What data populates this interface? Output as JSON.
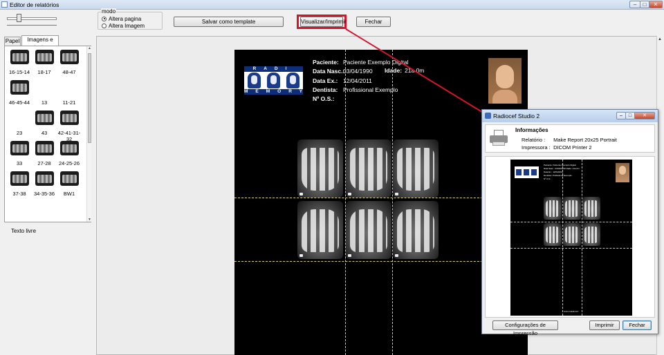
{
  "window": {
    "title": "Editor de relatórios",
    "minimize": "–",
    "maximize": "□",
    "close": "✕"
  },
  "toolbar": {
    "modo_legend": "modo",
    "radio_altera_pagina": "Altera pagina",
    "radio_altera_imagem": "Altera Imagem",
    "selected_mode": "Altera pagina",
    "save_template_label": "Salvar como template",
    "visualizar_label": "Visualizar/Imprimir",
    "fechar_label": "Fechar",
    "highlight_color": "#d6152b"
  },
  "left_panel": {
    "tabs": [
      "Papel",
      "Imagens e texto"
    ],
    "active_tab": "Imagens e texto",
    "thumbnails": [
      "16-15-14",
      "18-17",
      "48-47",
      "46-45-44",
      "13",
      "11-21",
      "23",
      "43",
      "42-41-31-32",
      "33",
      "27-28",
      "24-25-26",
      "37-38",
      "34-35-36",
      "BW1"
    ],
    "texto_livre": "Texto livre"
  },
  "report": {
    "labels": {
      "paciente": "Paciente:",
      "data_nasc": "Data Nasc.:",
      "data_ex": "Data Ex.:",
      "dentista": "Dentista:",
      "os": "Nº O.S.:",
      "idade": "Idade:"
    },
    "values": {
      "paciente": "Paciente Exemplo Digital",
      "data_nasc": "03/04/1990",
      "data_ex": "12/04/2011",
      "dentista": "Profissional Exemplo",
      "os": "",
      "idade": "21a 0m"
    },
    "logo_top": "RADI",
    "logo_bottom": "MEMORY",
    "logo_color": "#0e2e7a"
  },
  "dialog": {
    "title": "Radiocef Studio 2",
    "info_title": "Informações",
    "relatorio_label": "Relatório :",
    "relatorio_value": "Make Report 20x25  Portrait",
    "impressora_label": "Impressora :",
    "impressora_value": "DICOM Printer 2",
    "btn_config": "Configurações de Impressão",
    "btn_imprimir": "Imprimir",
    "btn_fechar": "Fechar"
  }
}
